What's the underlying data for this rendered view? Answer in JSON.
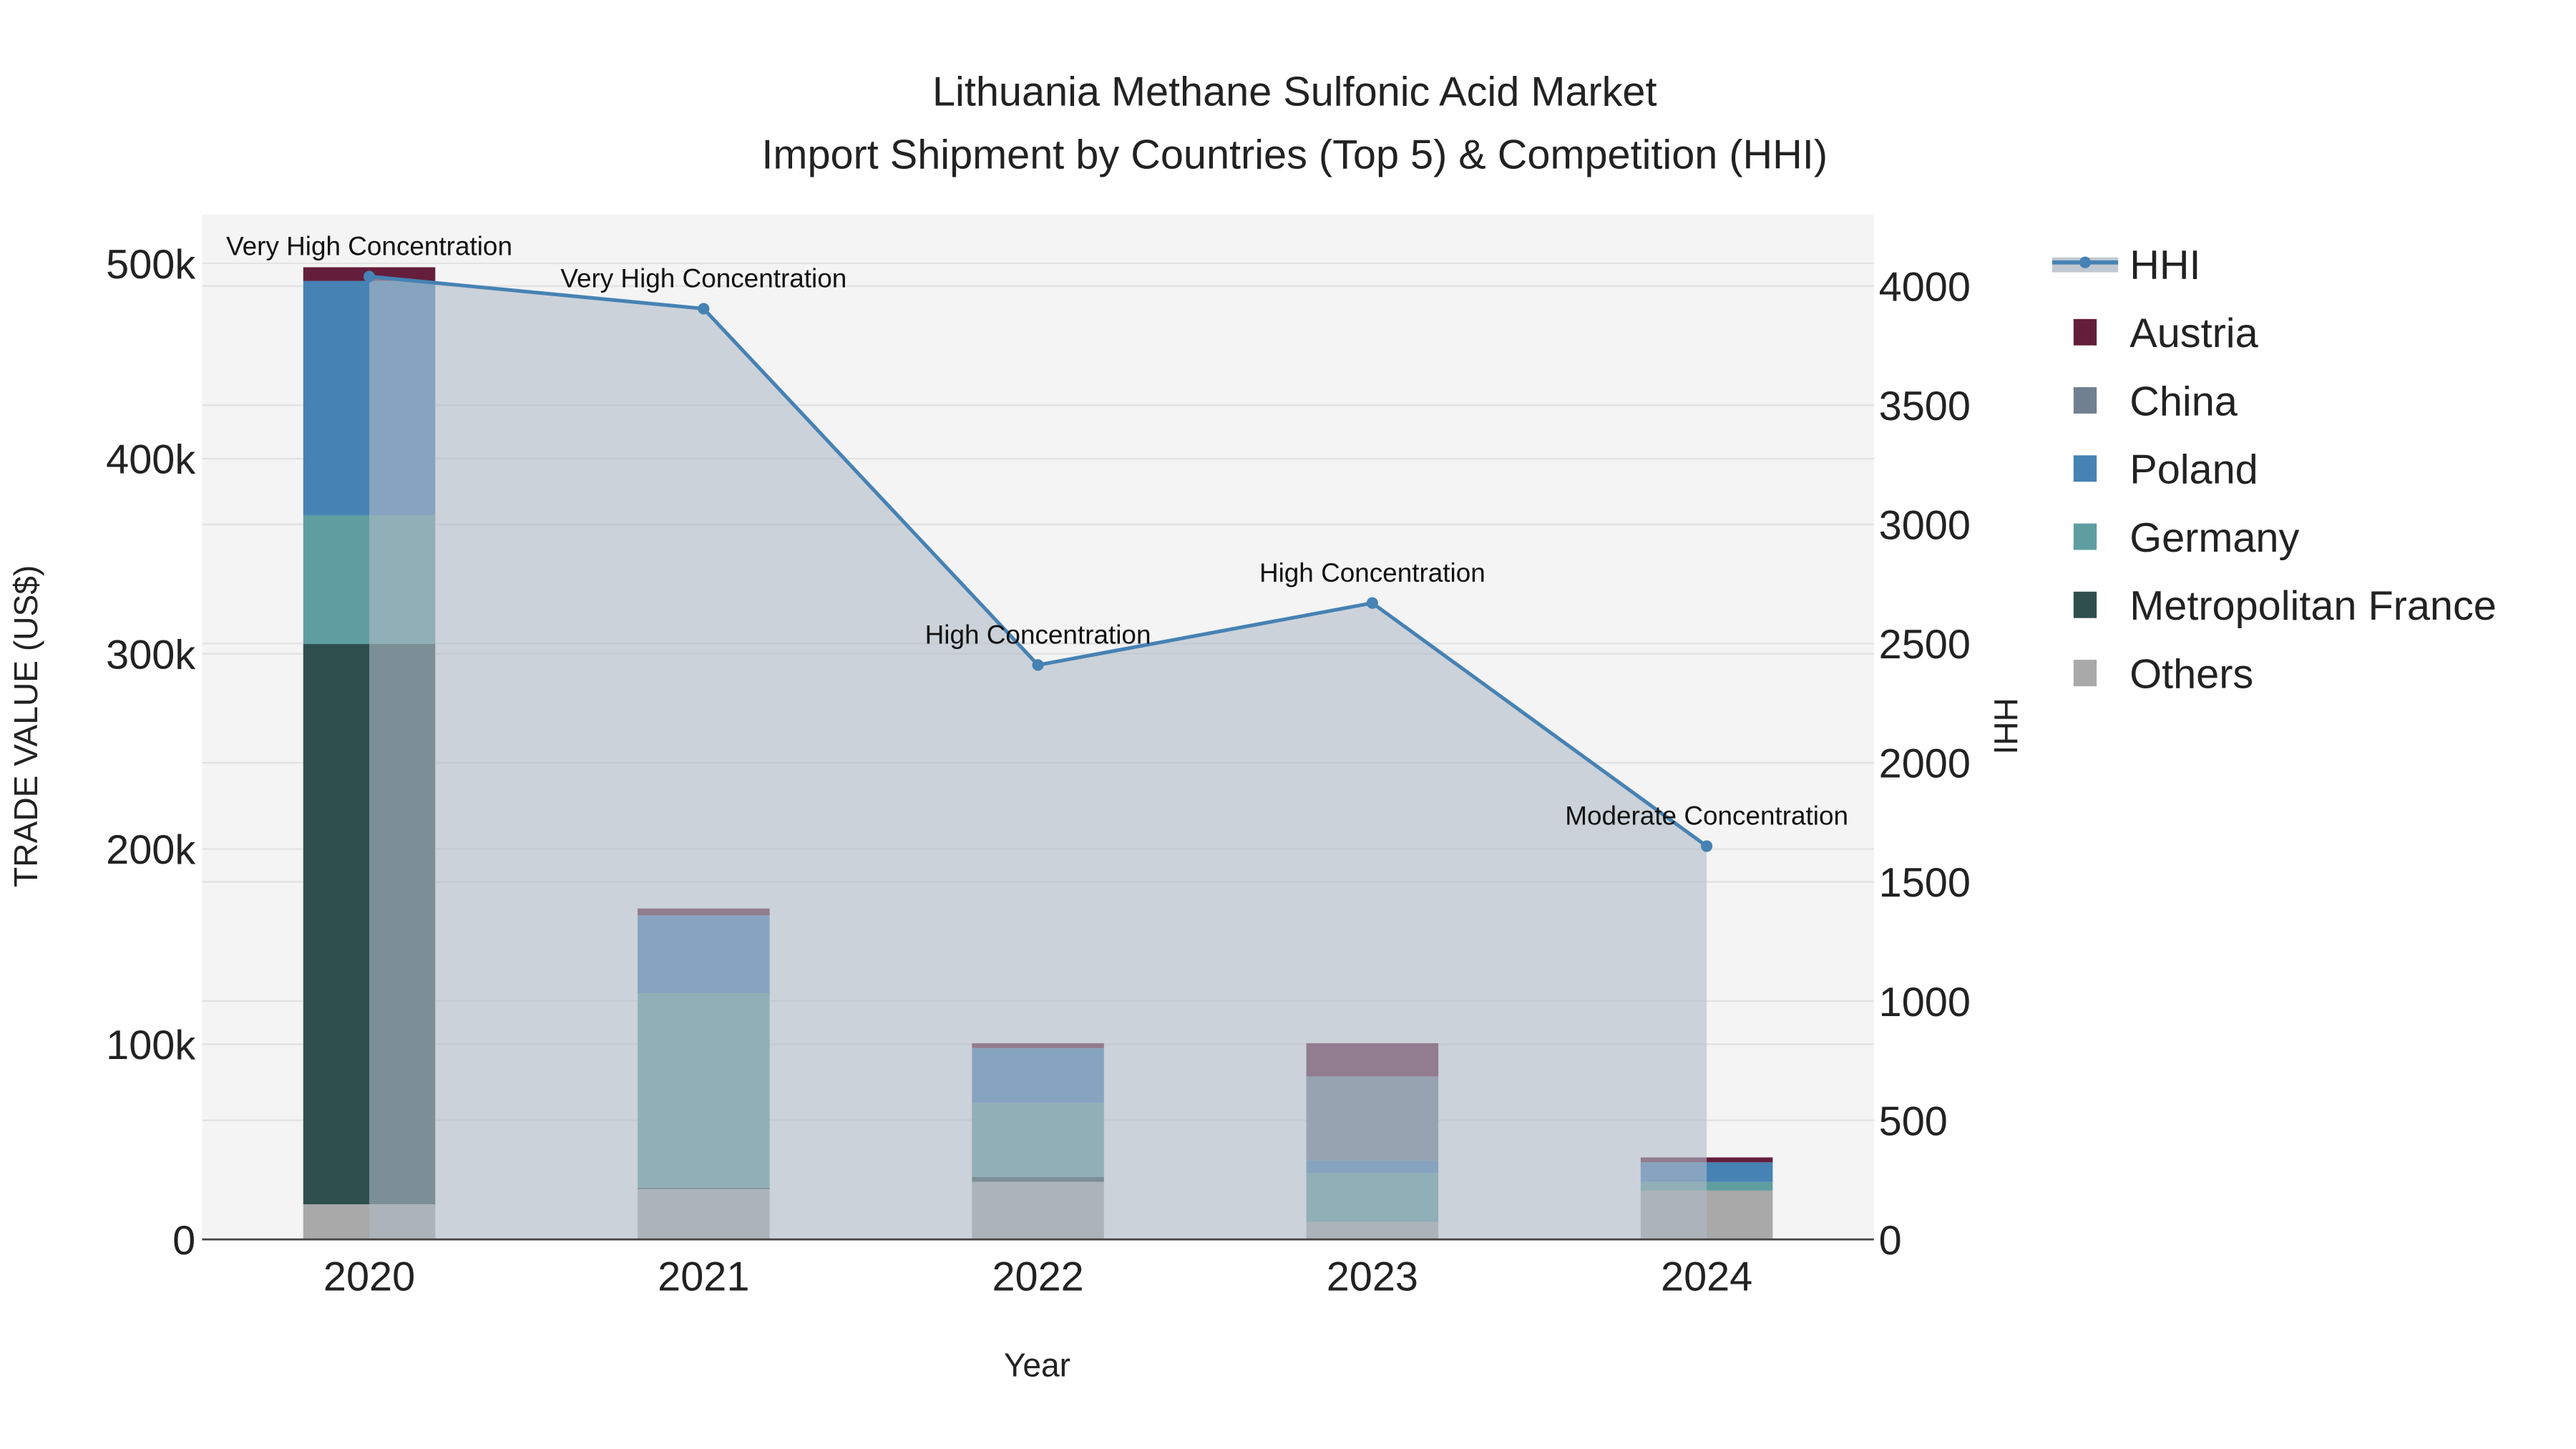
{
  "chart_data": {
    "type": "bar",
    "title_line1": "Lithuania Methane Sulfonic Acid Market",
    "title_line2": "Import Shipment by Countries (Top 5) & Competition (HHI)",
    "xlabel": "Year",
    "ylabel": "TRADE VALUE (US$)",
    "y2label": "HHI",
    "categories": [
      "2020",
      "2021",
      "2022",
      "2023",
      "2024"
    ],
    "ylim": [
      0,
      525000
    ],
    "y2lim": [
      0,
      4300
    ],
    "yticks": [
      0,
      100000,
      200000,
      300000,
      400000,
      500000
    ],
    "ytick_labels": [
      "0",
      "100k",
      "200k",
      "300k",
      "400k",
      "500k"
    ],
    "y2ticks": [
      0,
      500,
      1000,
      1500,
      2000,
      2500,
      3000,
      3500,
      4000
    ],
    "y2tick_labels": [
      "0",
      "500",
      "1000",
      "1500",
      "2000",
      "2500",
      "3000",
      "3500",
      "4000"
    ],
    "series": [
      {
        "name": "Others",
        "color": "#a9a9a9",
        "values": [
          18000,
          26000,
          29500,
          9000,
          25000
        ]
      },
      {
        "name": "Metropolitan France",
        "color": "#2f4f4f",
        "values": [
          287000,
          500,
          2500,
          0,
          0
        ]
      },
      {
        "name": "Germany",
        "color": "#5f9ea0",
        "values": [
          66000,
          99500,
          38000,
          25000,
          4500
        ]
      },
      {
        "name": "Poland",
        "color": "#4682b4",
        "values": [
          120000,
          40000,
          28000,
          6500,
          10000
        ]
      },
      {
        "name": "China",
        "color": "#708090",
        "values": [
          0,
          0,
          0,
          43000,
          0
        ]
      },
      {
        "name": "Austria",
        "color": "#641e3c",
        "values": [
          7000,
          3500,
          2500,
          17000,
          2500
        ]
      }
    ],
    "hhi": {
      "name": "HHI",
      "color": "#4682b4",
      "values": [
        4040,
        3905,
        2410,
        2670,
        1650
      ],
      "labels": [
        "Very High Concentration",
        "Very High Concentration",
        "High Concentration",
        "High Concentration",
        "Moderate Concentration"
      ]
    },
    "legend_order": [
      "HHI",
      "Austria",
      "China",
      "Poland",
      "Germany",
      "Metropolitan France",
      "Others"
    ],
    "legend_position": "right",
    "grid": true
  }
}
